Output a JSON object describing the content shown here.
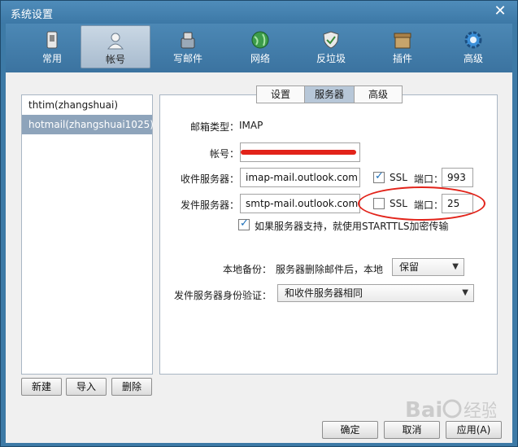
{
  "window": {
    "title": "系统设置"
  },
  "toolbar": {
    "items": [
      {
        "label": "常用",
        "icon": "phone-icon"
      },
      {
        "label": "帐号",
        "icon": "user-icon"
      },
      {
        "label": "写邮件",
        "icon": "compose-icon"
      },
      {
        "label": "网络",
        "icon": "globe-icon"
      },
      {
        "label": "反垃圾",
        "icon": "shield-icon"
      },
      {
        "label": "插件",
        "icon": "box-icon"
      },
      {
        "label": "高级",
        "icon": "gear-icon"
      }
    ]
  },
  "accounts": [
    "thtim(zhangshuai)",
    "hotmail(zhangshuai1025)"
  ],
  "account_buttons": {
    "new": "新建",
    "import": "导入",
    "delete": "删除"
  },
  "tabs": [
    "设置",
    "服务器",
    "高级"
  ],
  "server": {
    "mailbox_type_label": "邮箱类型：",
    "mailbox_type_value": "IMAP",
    "account_label": "帐号：",
    "incoming_label": "收件服务器：",
    "incoming_value": "imap-mail.outlook.com",
    "outgoing_label": "发件服务器：",
    "outgoing_value": "smtp-mail.outlook.com",
    "ssl_label": "SSL",
    "port_label": "端口：",
    "incoming_port": "993",
    "outgoing_port": "25",
    "starttls_label": "如果服务器支持，就使用STARTTLS加密传输",
    "local_backup_label": "本地备份：",
    "local_backup_desc": "服务器删除邮件后，本地",
    "local_backup_value": "保留",
    "smtp_auth_label": "发件服务器身份验证：",
    "smtp_auth_value": "和收件服务器相同"
  },
  "footer": {
    "ok": "确定",
    "cancel": "取消",
    "apply": "应用(A)"
  },
  "watermark": {
    "text": "Baidu 经验"
  },
  "colors": {
    "titlebar": "#3d7aa6",
    "highlight": "#8ea4bb",
    "annotation": "#e2231a"
  }
}
